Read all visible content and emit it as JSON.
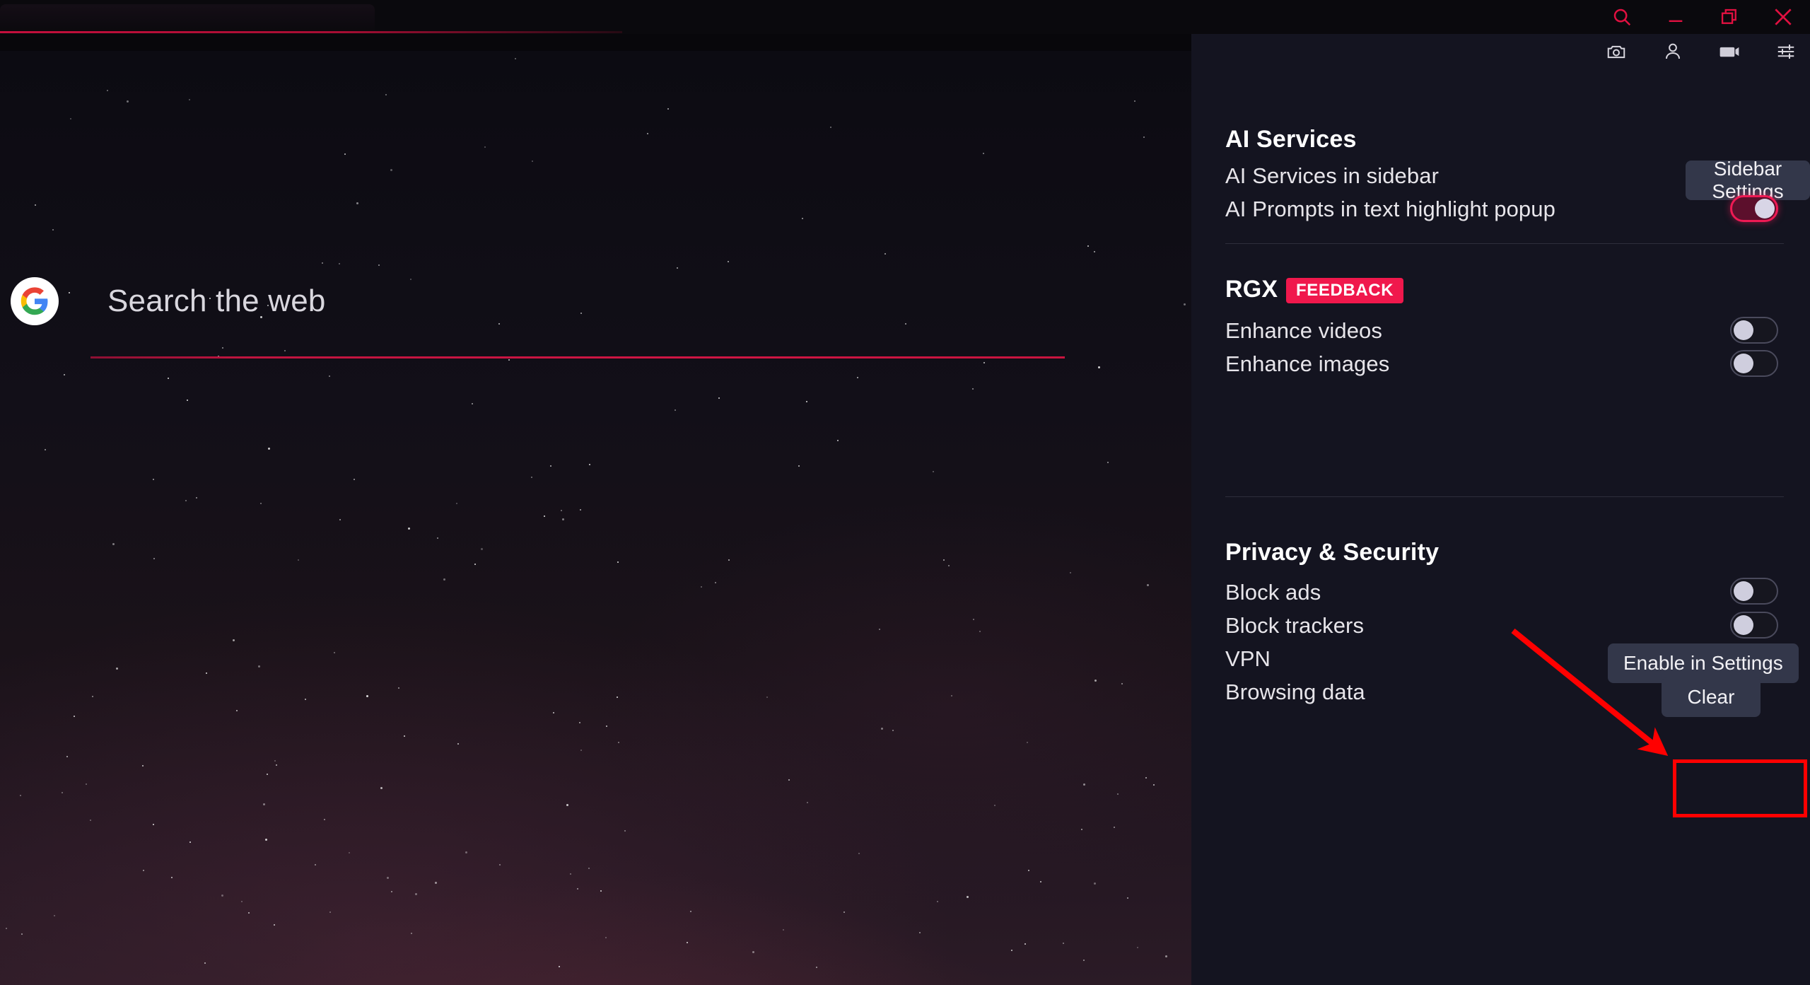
{
  "window": {
    "controls": [
      {
        "name": "search",
        "icon": "search-icon",
        "label": "Search"
      },
      {
        "name": "minimize",
        "icon": "minimize-icon",
        "label": "Minimize"
      },
      {
        "name": "restore",
        "icon": "restore-icon",
        "label": "Restore"
      },
      {
        "name": "close",
        "icon": "close-icon",
        "label": "Close"
      }
    ]
  },
  "toolbar": {
    "items": [
      {
        "name": "screenshot",
        "icon": "camera-icon",
        "label": "Snapshot"
      },
      {
        "name": "profile",
        "icon": "person-icon",
        "label": "Profile"
      },
      {
        "name": "video",
        "icon": "video-icon",
        "label": "Video"
      },
      {
        "name": "quick-settings",
        "icon": "sliders-icon",
        "label": "Quick settings"
      }
    ]
  },
  "search": {
    "engine_icon": "google-logo",
    "placeholder": "Search the web",
    "value": ""
  },
  "panel": {
    "sections": [
      {
        "title": "AI Services",
        "rows": [
          {
            "label": "AI Services in sidebar",
            "control": "button",
            "button_label": "Sidebar Settings"
          },
          {
            "label": "AI Prompts in text highlight popup",
            "control": "toggle",
            "state": "on"
          }
        ]
      },
      {
        "title": "RGX",
        "badge": "FEEDBACK",
        "rows": [
          {
            "label": "Enhance videos",
            "control": "toggle",
            "state": "off"
          },
          {
            "label": "Enhance images",
            "control": "toggle",
            "state": "off"
          }
        ]
      },
      {
        "title": "Privacy & Security",
        "rows": [
          {
            "label": "Block ads",
            "control": "toggle",
            "state": "off",
            "highlighted": true
          },
          {
            "label": "Block trackers",
            "control": "toggle",
            "state": "off"
          },
          {
            "label": "VPN",
            "control": "button",
            "button_label": "Enable in Settings"
          },
          {
            "label": "Browsing data",
            "control": "button",
            "button_label": "Clear"
          }
        ]
      }
    ]
  },
  "colors": {
    "accent": "#ef1a54",
    "badge": "#f0184c",
    "button": "#33374a",
    "panel_bg": "#141420",
    "annotation": "#ff0000"
  }
}
